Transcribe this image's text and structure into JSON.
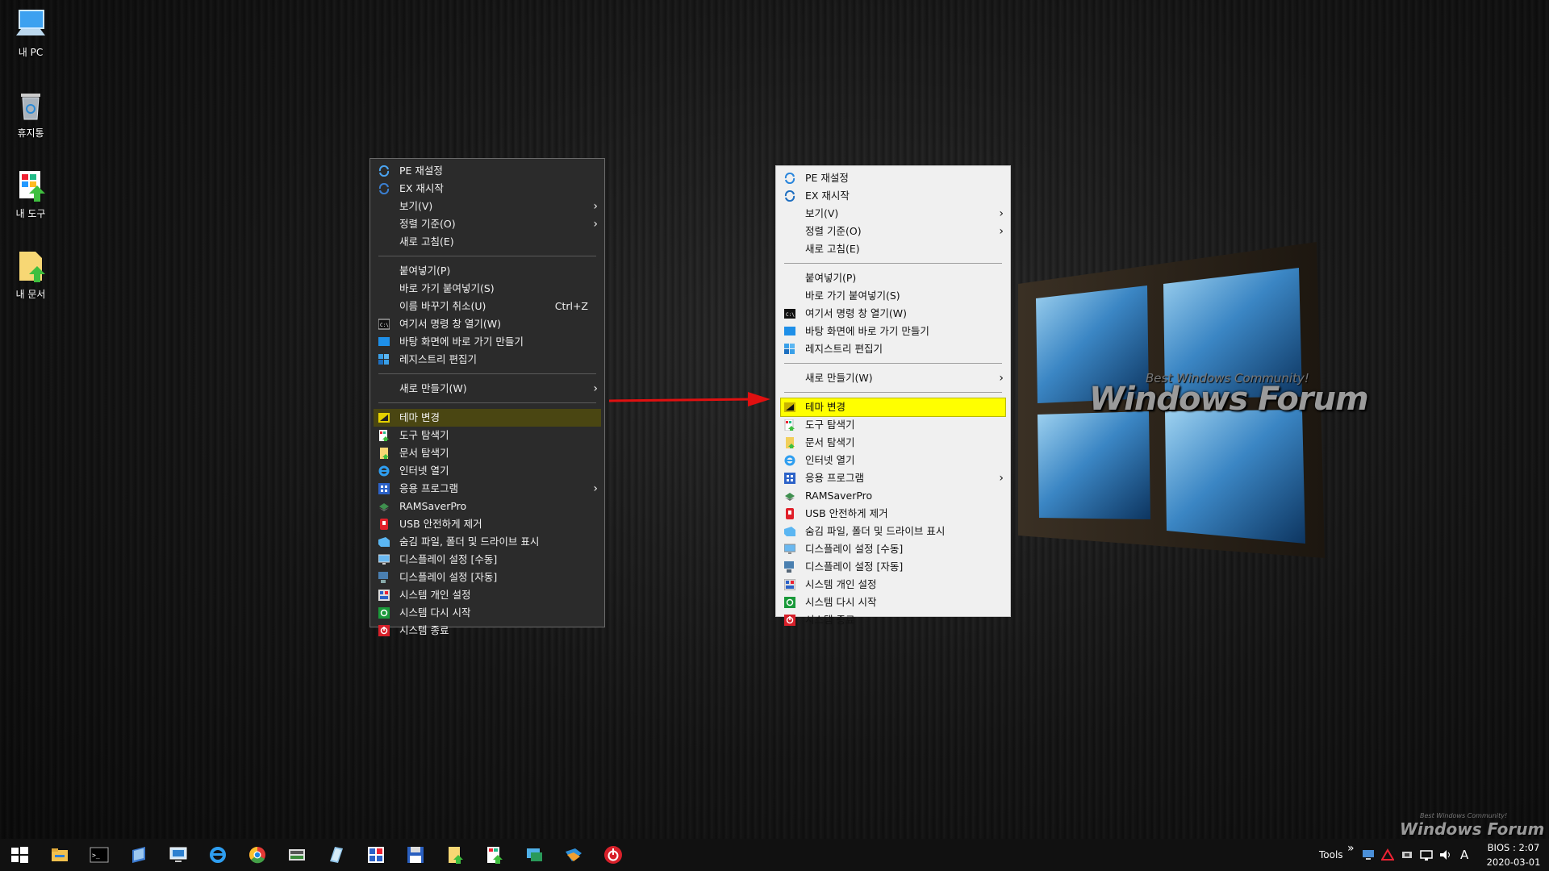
{
  "desktop": {
    "icons": [
      {
        "label": "내 PC",
        "icon": "computer-icon"
      },
      {
        "label": "휴지통",
        "icon": "recycle-bin-icon"
      },
      {
        "label": "내 도구",
        "icon": "tools-shortcut-icon"
      },
      {
        "label": "내 문서",
        "icon": "documents-shortcut-icon"
      }
    ],
    "watermark": {
      "title": "Windows Forum",
      "subtitle": "Best Windows Community!"
    }
  },
  "dark_menu": {
    "items": [
      {
        "label": "PE 재설정",
        "icon": "refresh-icon"
      },
      {
        "label": "EX 재시작",
        "icon": "restart-icon"
      },
      {
        "label": "보기(V)",
        "submenu": true
      },
      {
        "label": "정렬 기준(O)",
        "submenu": true
      },
      {
        "label": "새로 고침(E)"
      },
      {
        "label": "붙여넣기(P)"
      },
      {
        "label": "바로 가기 붙여넣기(S)"
      },
      {
        "label": "이름 바꾸기 취소(U)",
        "shortcut": "Ctrl+Z"
      },
      {
        "label": "여기서 명령 창 열기(W)",
        "icon": "cmd-icon"
      },
      {
        "label": "바탕 화면에 바로 가기 만들기",
        "icon": "desktop-shortcut-icon"
      },
      {
        "label": "레지스트리 편집기",
        "icon": "registry-icon"
      },
      {
        "label": "새로 만들기(W)",
        "submenu": true
      },
      {
        "label": "테마 변경",
        "icon": "theme-icon",
        "highlighted": true
      },
      {
        "label": "도구 탐색기",
        "icon": "tools-icon"
      },
      {
        "label": "문서 탐색기",
        "icon": "documents-icon"
      },
      {
        "label": "인터넷 열기",
        "icon": "ie-icon"
      },
      {
        "label": "응용 프로그램",
        "icon": "apps-icon",
        "submenu": true
      },
      {
        "label": "RAMSaverPro",
        "icon": "ram-icon"
      },
      {
        "label": "USB 안전하게 제거",
        "icon": "usb-icon"
      },
      {
        "label": "숨김 파일, 폴더 및 드라이브 표시",
        "icon": "hidden-files-icon"
      },
      {
        "label": "디스플레이 설정 [수동]",
        "icon": "display-manual-icon"
      },
      {
        "label": "디스플레이 설정 [자동]",
        "icon": "display-auto-icon"
      },
      {
        "label": "시스템 개인 설정",
        "icon": "personalize-icon"
      },
      {
        "label": "시스템 다시 시작",
        "icon": "reboot-icon"
      },
      {
        "label": "시스템 종료",
        "icon": "shutdown-icon"
      }
    ]
  },
  "light_menu": {
    "items": [
      {
        "label": "PE 재설정",
        "icon": "refresh-icon"
      },
      {
        "label": "EX 재시작",
        "icon": "restart-icon"
      },
      {
        "label": "보기(V)",
        "submenu": true
      },
      {
        "label": "정렬 기준(O)",
        "submenu": true
      },
      {
        "label": "새로 고침(E)"
      },
      {
        "label": "붙여넣기(P)"
      },
      {
        "label": "바로 가기 붙여넣기(S)"
      },
      {
        "label": "여기서 명령 창 열기(W)",
        "icon": "cmd-icon"
      },
      {
        "label": "바탕 화면에 바로 가기 만들기",
        "icon": "desktop-shortcut-icon"
      },
      {
        "label": "레지스트리 편집기",
        "icon": "registry-icon"
      },
      {
        "label": "새로 만들기(W)",
        "submenu": true
      },
      {
        "label": "테마 변경",
        "icon": "theme-icon",
        "highlighted": true
      },
      {
        "label": "도구 탐색기",
        "icon": "tools-icon"
      },
      {
        "label": "문서 탐색기",
        "icon": "documents-icon"
      },
      {
        "label": "인터넷 열기",
        "icon": "ie-icon"
      },
      {
        "label": "응용 프로그램",
        "icon": "apps-icon",
        "submenu": true
      },
      {
        "label": "RAMSaverPro",
        "icon": "ram-icon"
      },
      {
        "label": "USB 안전하게 제거",
        "icon": "usb-icon"
      },
      {
        "label": "숨김 파일, 폴더 및 드라이브 표시",
        "icon": "hidden-files-icon"
      },
      {
        "label": "디스플레이 설정 [수동]",
        "icon": "display-manual-icon"
      },
      {
        "label": "디스플레이 설정 [자동]",
        "icon": "display-auto-icon"
      },
      {
        "label": "시스템 개인 설정",
        "icon": "personalize-icon"
      },
      {
        "label": "시스템 다시 시작",
        "icon": "reboot-icon"
      },
      {
        "label": "시스템 종료",
        "icon": "shutdown-icon"
      }
    ]
  },
  "taskbar": {
    "apps": [
      "start-icon",
      "file-explorer-icon",
      "cmd-icon",
      "notepad-icon",
      "remote-desktop-icon",
      "ie-icon",
      "chrome-icon",
      "disk-icon",
      "tool-icon",
      "apps-grid-icon",
      "save-icon",
      "documents-icon",
      "tools-icon",
      "network-icon",
      "folder-app-icon",
      "power-icon"
    ],
    "tools_label": "Tools",
    "ime": "A",
    "clock_line1": "BIOS : 2:07",
    "clock_line2": "2020-03-01"
  },
  "colors": {
    "highlight_light": "#ffff00",
    "highlight_dark": "#4a4612",
    "arrow": "#e01010"
  }
}
